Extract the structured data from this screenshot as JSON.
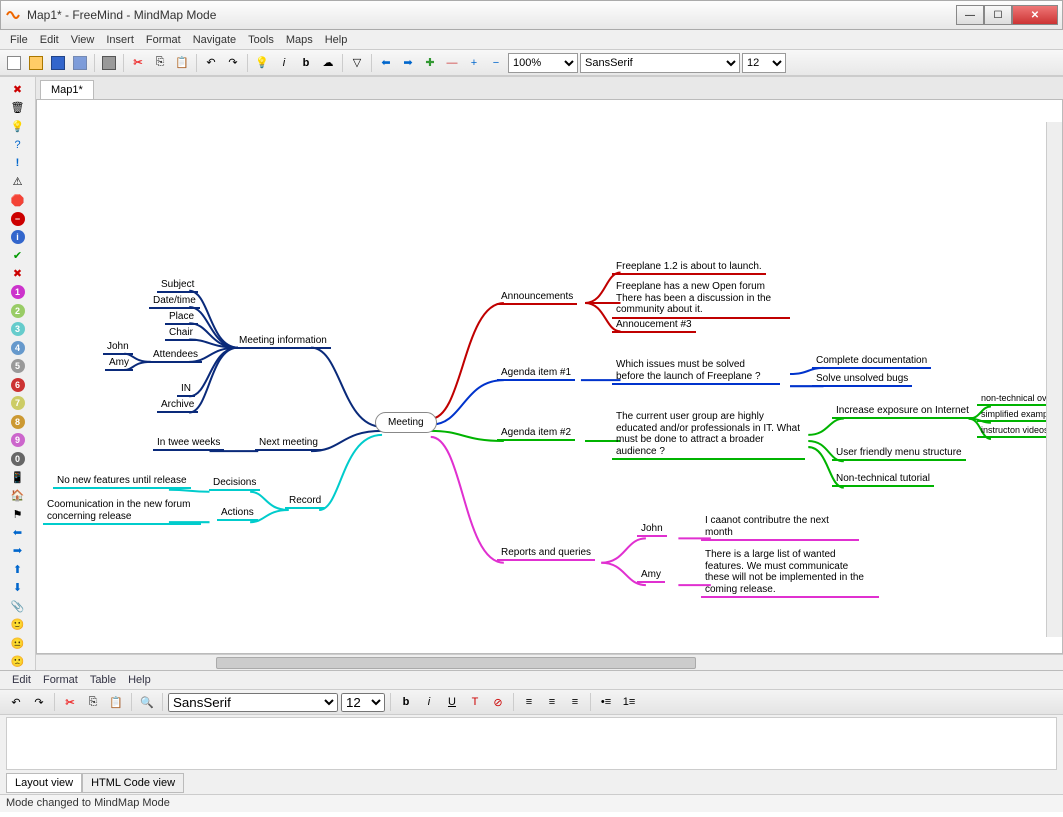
{
  "window": {
    "title": "Map1* - FreeMind - MindMap Mode"
  },
  "menus": [
    "File",
    "Edit",
    "View",
    "Insert",
    "Format",
    "Navigate",
    "Tools",
    "Maps",
    "Help"
  ],
  "toolbar": {
    "zoom": "100%",
    "font": "SansSerif",
    "fontsize": "12"
  },
  "tab": {
    "label": "Map1*"
  },
  "mindmap": {
    "root": "Meeting",
    "left": {
      "meeting_info": {
        "label": "Meeting information",
        "children": {
          "subject": "Subject",
          "datetime": "Date/time",
          "place": "Place",
          "chair": "Chair",
          "attendees": {
            "label": "Attendees",
            "children": {
              "john": "John",
              "amy": "Amy"
            }
          },
          "in": "IN",
          "archive": "Archive"
        }
      },
      "next_meeting": {
        "label": "Next meeting",
        "child": "In twee weeks"
      },
      "record": {
        "label": "Record",
        "decisions": {
          "label": "Decisions",
          "child": "No new features until release"
        },
        "actions": {
          "label": "Actions",
          "child": "Coomunication in the new forum concerning release"
        }
      }
    },
    "right": {
      "announcements": {
        "label": "Announcements",
        "a1": "Freeplane 1.2 is about to launch.",
        "a2": "Freeplane has a new Open forum There has been a discussion in the community about it.",
        "a3": "Annoucement #3"
      },
      "agenda1": {
        "label": "Agenda item #1",
        "q": "Which issues must be solved before the launch of Freeplane ?",
        "c1": "Complete documentation",
        "c2": "Solve unsolved bugs"
      },
      "agenda2": {
        "label": "Agenda item #2",
        "q": "The current user group are highly educated and/or professionals in IT. What must be done to attract a broader audience ?",
        "r1": {
          "label": "Increase exposure on Internet",
          "c1": "non-technical overview of possibilities",
          "c2": "simplified example maps",
          "c3": "instructon videos"
        },
        "r2": "User friendly menu structure",
        "r3": "Non-technical tutorial"
      },
      "reports": {
        "label": "Reports and queries",
        "john": {
          "label": "John",
          "text": "I caanot contributre the next month"
        },
        "amy": {
          "label": "Amy",
          "text": "There is a large list of wanted features. We must communicate these will not be implemented in the coming release."
        }
      }
    }
  },
  "bottom": {
    "menus": [
      "Edit",
      "Format",
      "Table",
      "Help"
    ],
    "font": "SansSerif",
    "fontsize": "12",
    "tab1": "Layout view",
    "tab2": "HTML Code view"
  },
  "status": "Mode changed to MindMap Mode",
  "colors": {
    "navy": "#0a2a7a",
    "red": "#c00000",
    "blue": "#0033cc",
    "green": "#00b300",
    "cyan": "#00cccc",
    "magenta": "#e030d0",
    "darknavy": "#081c5a"
  }
}
